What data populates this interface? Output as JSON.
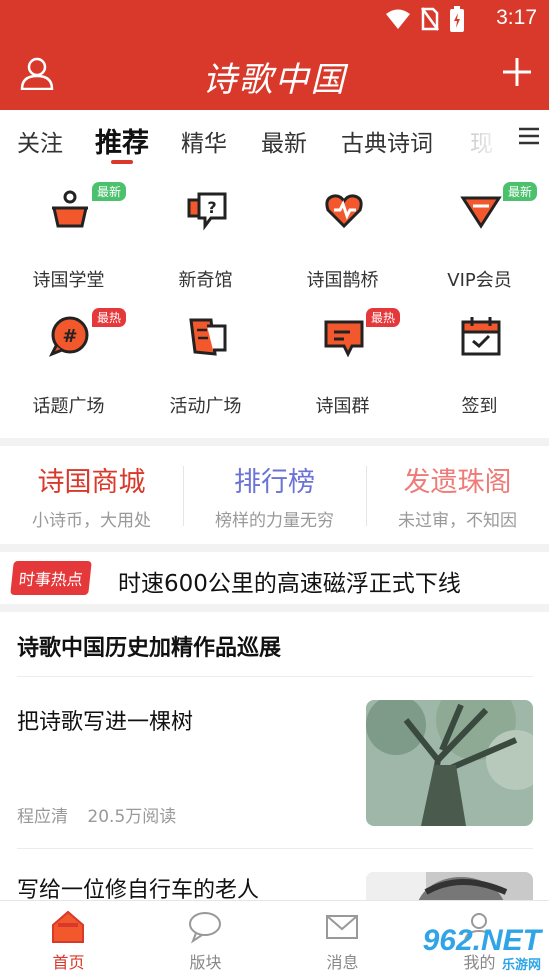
{
  "status_bar": {
    "time": "3:17"
  },
  "header": {
    "title": "诗歌中国",
    "icons": [
      "user-icon",
      "add-icon"
    ],
    "color": "#d8392b"
  },
  "tabs": [
    {
      "label": "关注"
    },
    {
      "label": "推荐",
      "active": true
    },
    {
      "label": "精华"
    },
    {
      "label": "最新"
    },
    {
      "label": "古典诗词"
    },
    {
      "label": "现"
    }
  ],
  "grid": [
    {
      "label": "诗国学堂",
      "badge": "最新",
      "icon": "classroom-icon"
    },
    {
      "label": "新奇馆",
      "badge": "",
      "icon": "question-icon"
    },
    {
      "label": "诗国鹊桥",
      "badge": "",
      "icon": "heart-icon"
    },
    {
      "label": "VIP会员",
      "badge": "最新",
      "icon": "diamond-icon"
    },
    {
      "label": "话题广场",
      "badge": "最热",
      "icon": "topic-icon"
    },
    {
      "label": "活动广场",
      "badge": "",
      "icon": "flag-icon"
    },
    {
      "label": "诗国群",
      "badge": "最热",
      "icon": "chat-group-icon"
    },
    {
      "label": "签到",
      "badge": "",
      "icon": "calendar-check-icon"
    }
  ],
  "promo": [
    {
      "title": "诗国商城",
      "subtitle": "小诗币，大用处",
      "color": "#d8392b"
    },
    {
      "title": "排行榜",
      "subtitle": "榜样的力量无穷",
      "color": "#6b73d6"
    },
    {
      "title": "发遗珠阁",
      "subtitle": "未过审，不知因",
      "color": "#ee7b78"
    }
  ],
  "hot": {
    "tag": "时事热点",
    "text": "时速600公里的高速磁浮正式下线"
  },
  "section": {
    "title": "诗歌中国历史加精作品巡展"
  },
  "articles": [
    {
      "title": "把诗歌写进一棵树",
      "author": "程应清",
      "reads": "20.5万阅读"
    },
    {
      "title": "写给一位修自行车的老人",
      "author": "",
      "reads": ""
    }
  ],
  "bottom_nav": [
    {
      "label": "首页",
      "active": true
    },
    {
      "label": "版块"
    },
    {
      "label": "消息"
    },
    {
      "label": "我的"
    }
  ],
  "watermark": {
    "brand": "962.NET",
    "sub": "乐游网"
  }
}
